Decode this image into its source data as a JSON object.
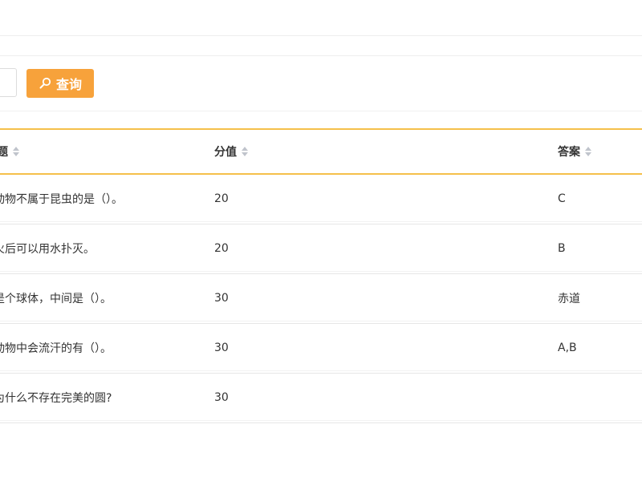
{
  "search": {
    "input_value": "",
    "button_label": "查询"
  },
  "table": {
    "headers": {
      "question": "题",
      "score": "分值",
      "answer": "答案"
    },
    "rows": [
      {
        "question": "动物不属于昆虫的是（）。",
        "score": "20",
        "answer": "C"
      },
      {
        "question": "火后可以用水扑灭。",
        "score": "20",
        "answer": "B"
      },
      {
        "question": "是个球体，中间是（）。",
        "score": "30",
        "answer": "赤道"
      },
      {
        "question": "动物中会流汗的有（）。",
        "score": "30",
        "answer": "A,B"
      },
      {
        "question": "为什么不存在完美的圆?",
        "score": "30",
        "answer": ""
      }
    ]
  },
  "colors": {
    "accent": "#f7a23b",
    "header_border": "#f5c04a",
    "sort_icon": "#c0c4cc"
  },
  "icons": {
    "search_button_icon": "search-icon",
    "sort_icon": "sort-icon"
  }
}
